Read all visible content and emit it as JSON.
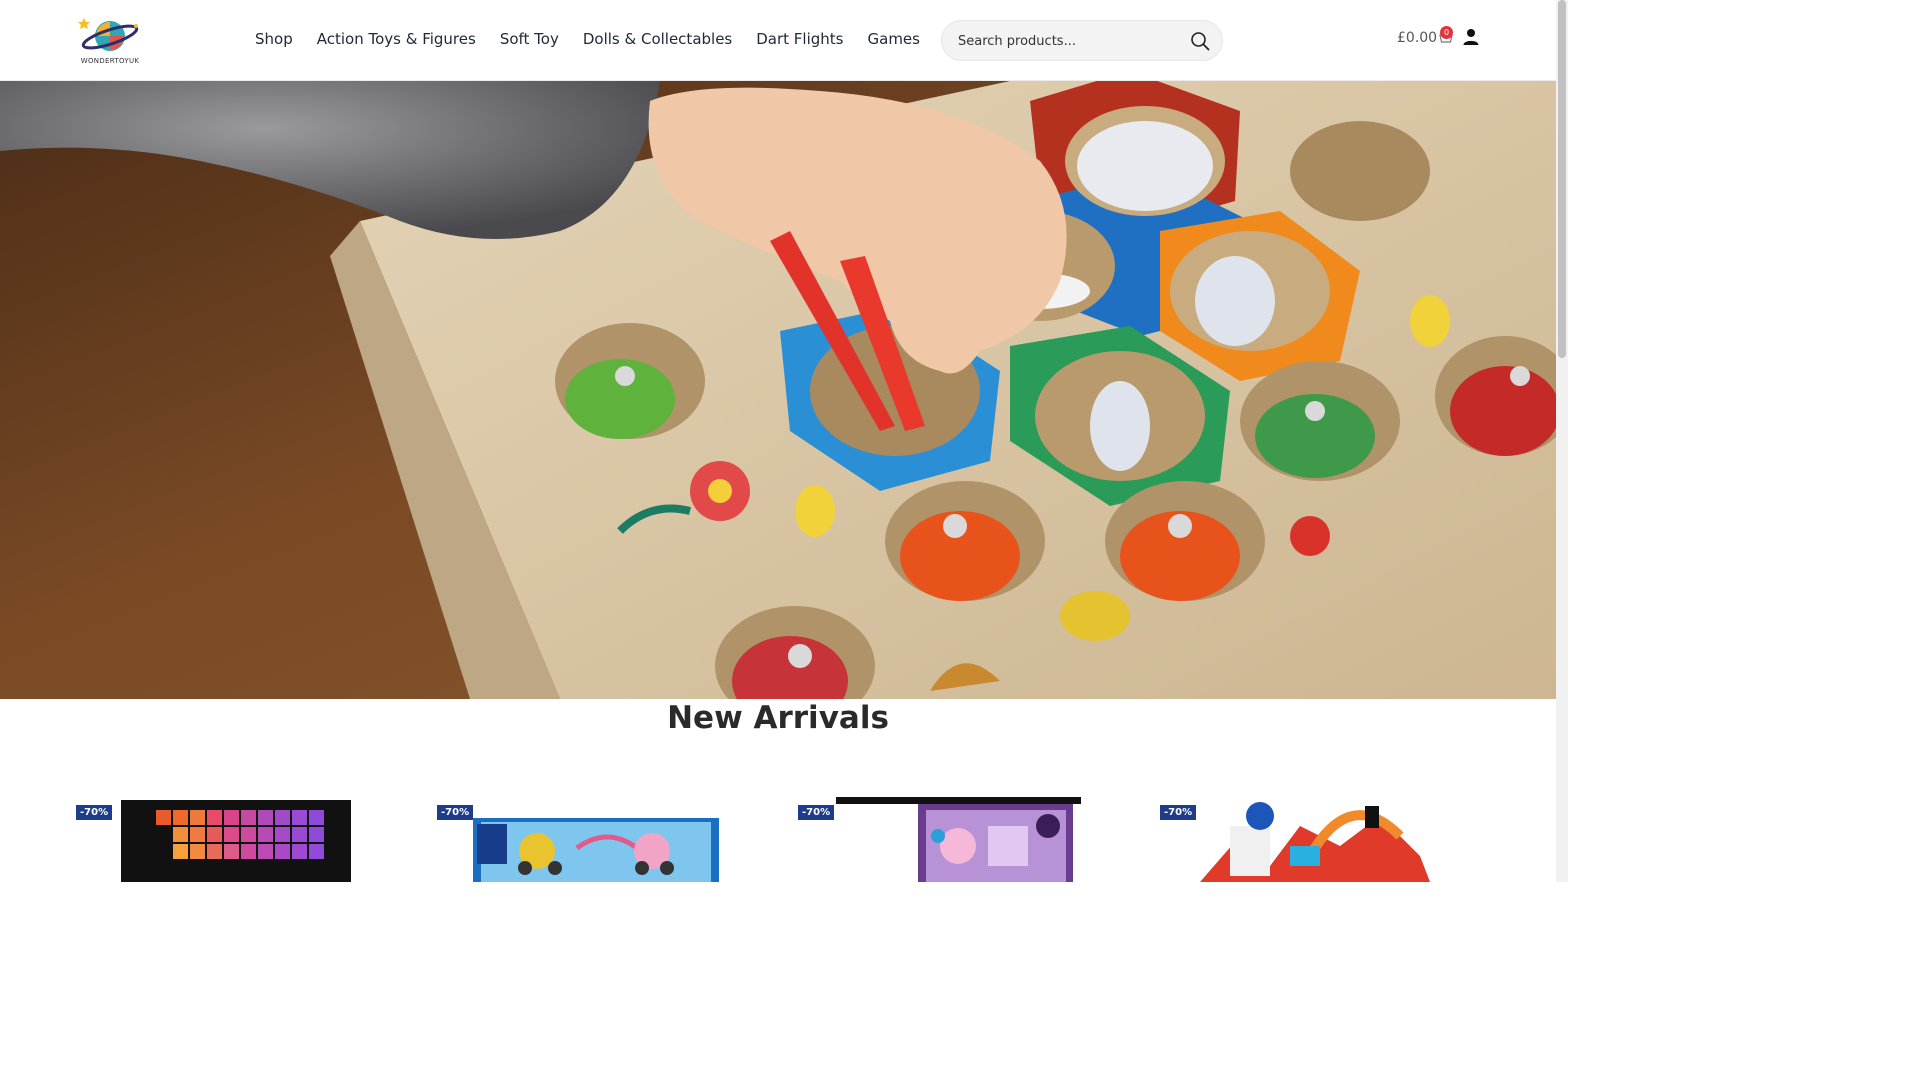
{
  "header": {
    "logo_text": "WONDERTOYUK",
    "nav": [
      {
        "label": "Shop"
      },
      {
        "label": "Action Toys & Figures"
      },
      {
        "label": "Soft Toy"
      },
      {
        "label": "Dolls & Collectables"
      },
      {
        "label": "Dart Flights"
      },
      {
        "label": "Games"
      }
    ],
    "search": {
      "placeholder": "Search products..."
    },
    "cart": {
      "amount": "£0.00",
      "count": "0"
    }
  },
  "hero": {
    "image": "child-playing-wooden-bee-hive-game"
  },
  "new_arrivals": {
    "title": "New Arrivals",
    "products": [
      {
        "badge": "-70%"
      },
      {
        "badge": "-70%"
      },
      {
        "badge": "-70%"
      },
      {
        "badge": "-70%"
      }
    ]
  },
  "colors": {
    "badge": "#1d3c8c",
    "cart_badge": "#e2343c"
  }
}
